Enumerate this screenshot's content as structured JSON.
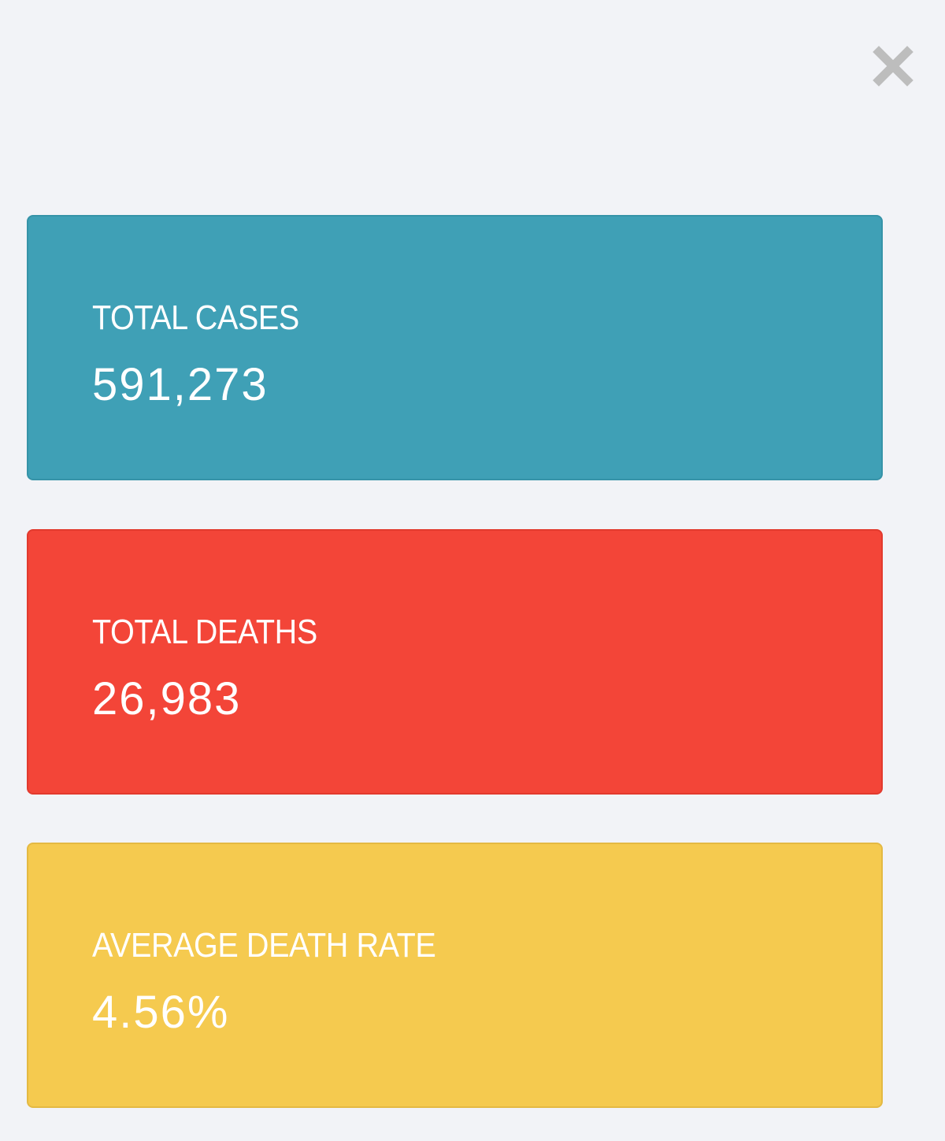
{
  "close": {
    "icon": "close-icon",
    "color": "#bdbdbd"
  },
  "stats": [
    {
      "label": "TOTAL CASES",
      "value": "591,273",
      "color": "#3fa0b6",
      "border": "#3693a8"
    },
    {
      "label": "TOTAL DEATHS",
      "value": "26,983",
      "color": "#f34538",
      "border": "#e23a2e"
    },
    {
      "label": "AVERAGE DEATH RATE",
      "value": "4.56%",
      "color": "#f5ca4f",
      "border": "#e4b943"
    }
  ]
}
